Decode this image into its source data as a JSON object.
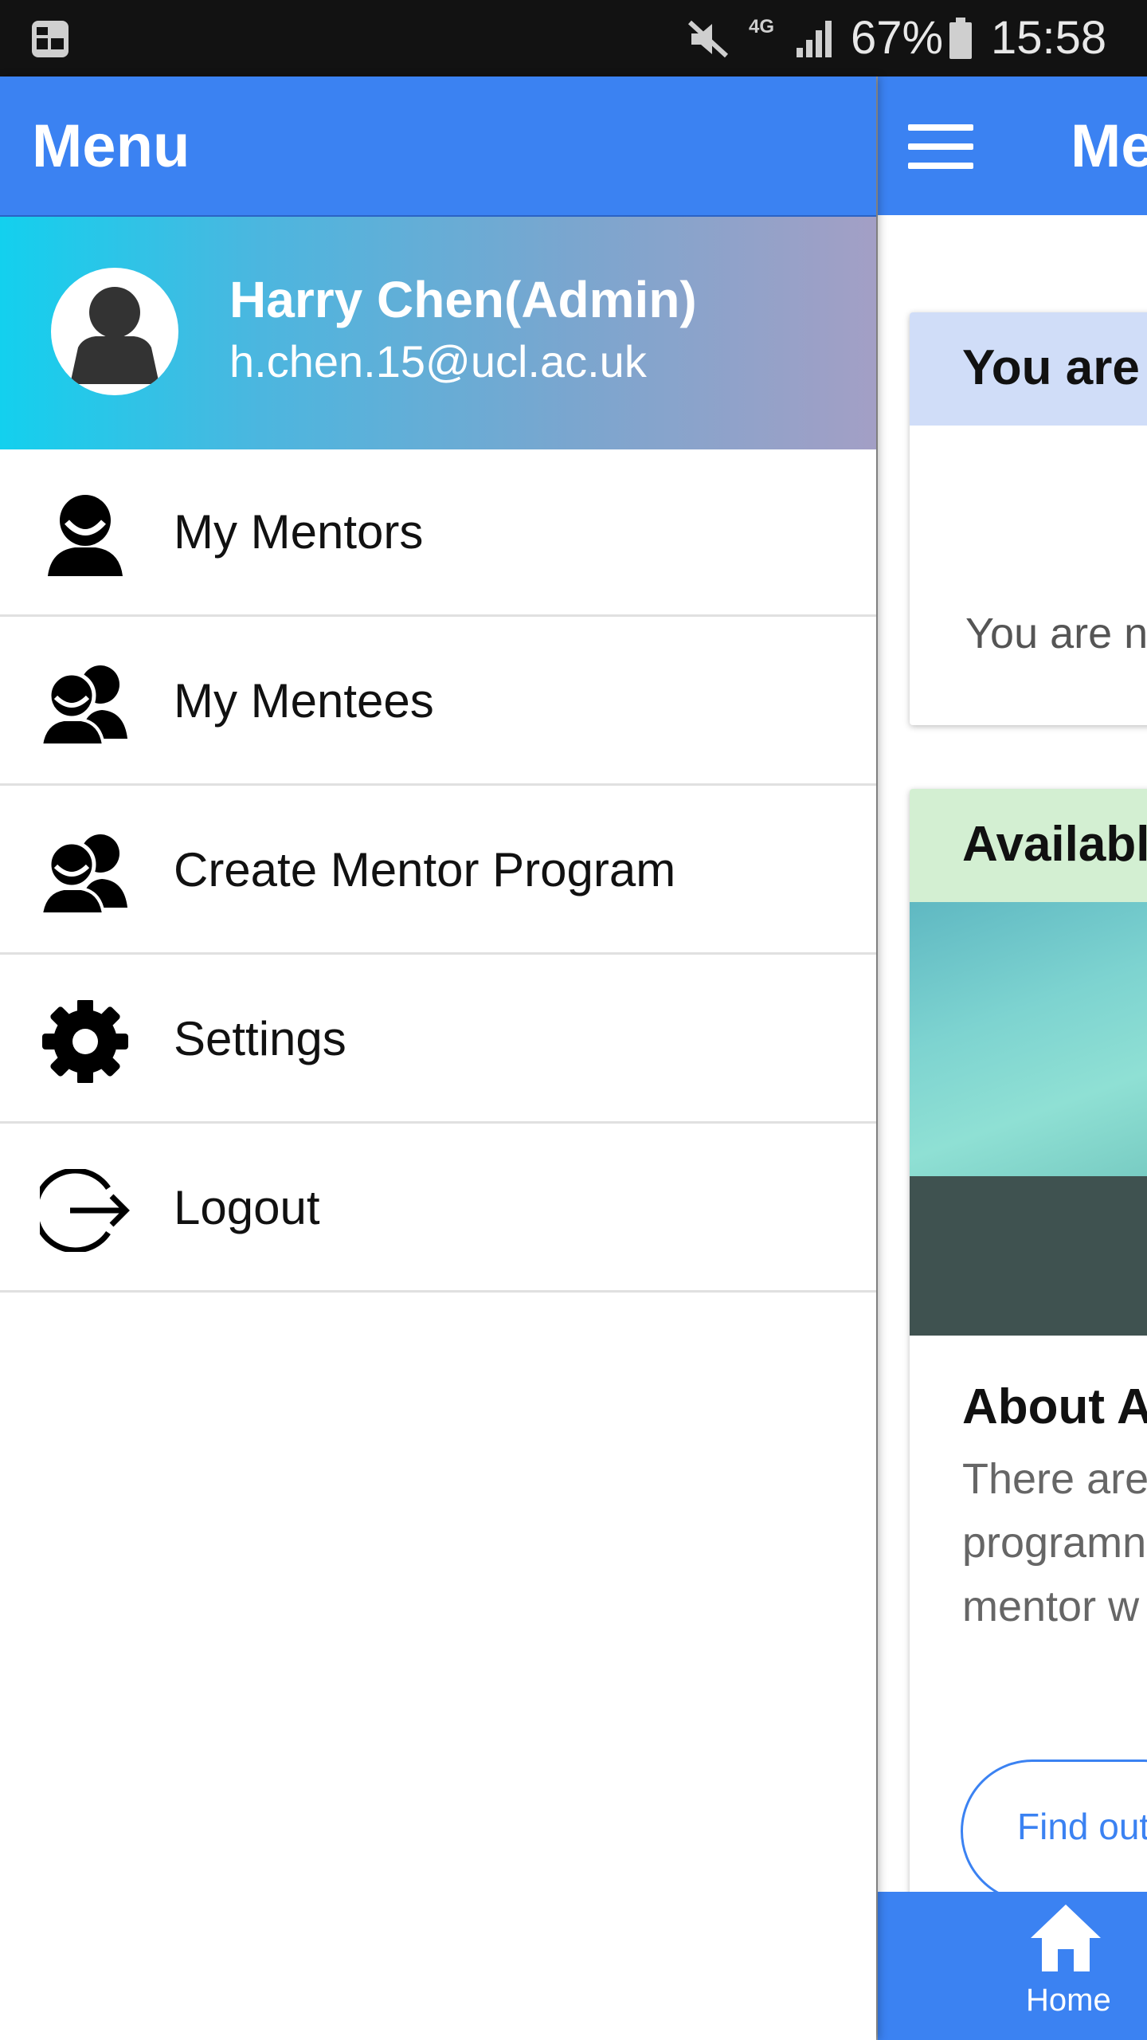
{
  "status_bar": {
    "network": "4G",
    "battery_percent": "67%",
    "time": "15:58",
    "icons": [
      "app-notification-icon",
      "mute-icon",
      "signal-icon",
      "battery-icon"
    ]
  },
  "drawer": {
    "title": "Menu",
    "profile": {
      "name": "Harry Chen(Admin)",
      "email": "h.chen.15@ucl.ac.uk"
    },
    "items": [
      {
        "label": "My Mentors",
        "icon": "person-icon"
      },
      {
        "label": "My Mentees",
        "icon": "people-icon"
      },
      {
        "label": "Create Mentor Program",
        "icon": "people-icon"
      },
      {
        "label": "Settings",
        "icon": "gear-icon"
      },
      {
        "label": "Logout",
        "icon": "logout-icon"
      }
    ]
  },
  "main": {
    "title": "Me",
    "card1": {
      "header": "You are",
      "body": "You are n"
    },
    "card2": {
      "header": "Available",
      "subtitle": "About A",
      "text_lines": [
        "There are",
        "programn",
        "mentor w"
      ],
      "button": "Find out"
    },
    "bottom_nav": {
      "home_label": "Home"
    }
  },
  "colors": {
    "primary": "#3b82f2",
    "profile_gradient_start": "#13d0ee",
    "profile_gradient_end": "#a39fc5"
  }
}
